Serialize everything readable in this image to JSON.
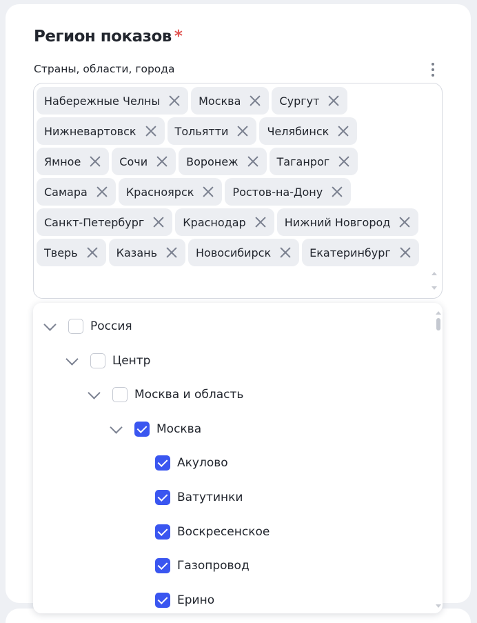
{
  "section": {
    "title": "Регион показов",
    "required_mark": "*",
    "field_label": "Страны, области, города",
    "more_icon": "vertical-dots-icon"
  },
  "tags": [
    [
      "Набережные Челны",
      "Москва",
      "Сургут"
    ],
    [
      "Нижневартовск",
      "Тольятти",
      "Челябинск"
    ],
    [
      "Ямное",
      "Сочи",
      "Воронеж",
      "Таганрог"
    ],
    [
      "Самара",
      "Красноярск",
      "Ростов-на-Дону"
    ],
    [
      "Санкт-Петербург",
      "Краснодар",
      "Нижний Новгород"
    ],
    [
      "Тверь",
      "Казань",
      "Новосибирск",
      "Екатеринбург"
    ]
  ],
  "tree": [
    {
      "label": "Россия",
      "level": 0,
      "expanded": true,
      "checked": false
    },
    {
      "label": "Центр",
      "level": 1,
      "expanded": true,
      "checked": false
    },
    {
      "label": "Москва и область",
      "level": 2,
      "expanded": true,
      "checked": false
    },
    {
      "label": "Москва",
      "level": 3,
      "expanded": true,
      "checked": true
    },
    {
      "label": "Акулово",
      "level": 4,
      "checked": true
    },
    {
      "label": "Ватутинки",
      "level": 4,
      "checked": true
    },
    {
      "label": "Воскресенское",
      "level": 4,
      "checked": true
    },
    {
      "label": "Газопровод",
      "level": 4,
      "checked": true
    },
    {
      "label": "Ерино",
      "level": 4,
      "checked": true
    }
  ],
  "colors": {
    "accent": "#3a56f0",
    "required": "#e0524f",
    "tag_background": "#eceef2"
  }
}
